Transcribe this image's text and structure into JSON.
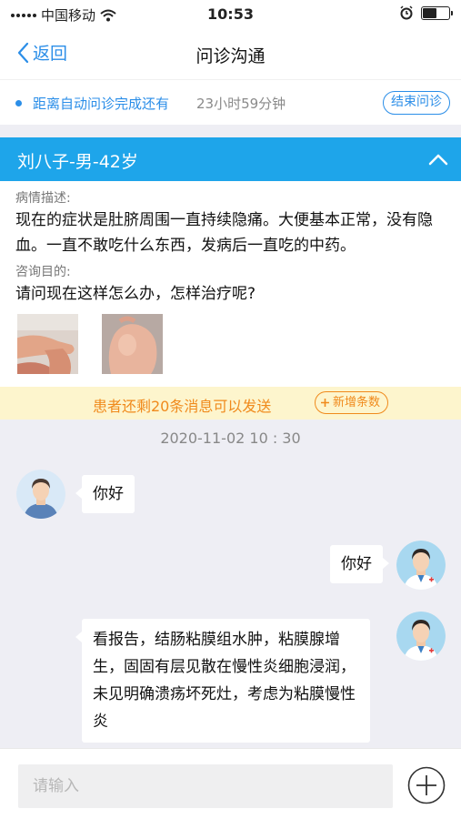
{
  "status_bar": {
    "carrier": "中国移动",
    "time": "10:53"
  },
  "nav": {
    "back_label": "返回",
    "title": "问诊沟通"
  },
  "timer": {
    "label": "距离自动问诊完成还有",
    "remaining": "23小时59分钟",
    "end_button": "结束问诊"
  },
  "patient": {
    "header": "刘八子-男-42岁",
    "desc_label": "病情描述:",
    "desc_text": "现在的症状是肚脐周围一直持续隐痛。大便基本正常，没有隐血。一直不敢吃什么东西，发病后一直吃的中药。",
    "purpose_label": "咨询目的:",
    "purpose_text": "请问现在这样怎么办，怎样治疗呢?"
  },
  "quota": {
    "text": "患者还剩20条消息可以发送",
    "add_button": "新增条数"
  },
  "chat": {
    "timestamp": "2020-11-02  10 : 30",
    "messages": [
      {
        "side": "left",
        "text": "你好"
      },
      {
        "side": "right",
        "text": "你好"
      },
      {
        "side": "right",
        "text": "看报告，结肠粘膜组水肿，粘膜腺增生，固固有层见散在慢性炎细胞浸润，未见明确溃疡坏死灶，考虑为粘膜慢性炎"
      }
    ]
  },
  "input": {
    "placeholder": "请输入"
  },
  "colors": {
    "accent": "#1ea5ea",
    "link": "#2b8ee8",
    "warning": "#f08a1c"
  }
}
